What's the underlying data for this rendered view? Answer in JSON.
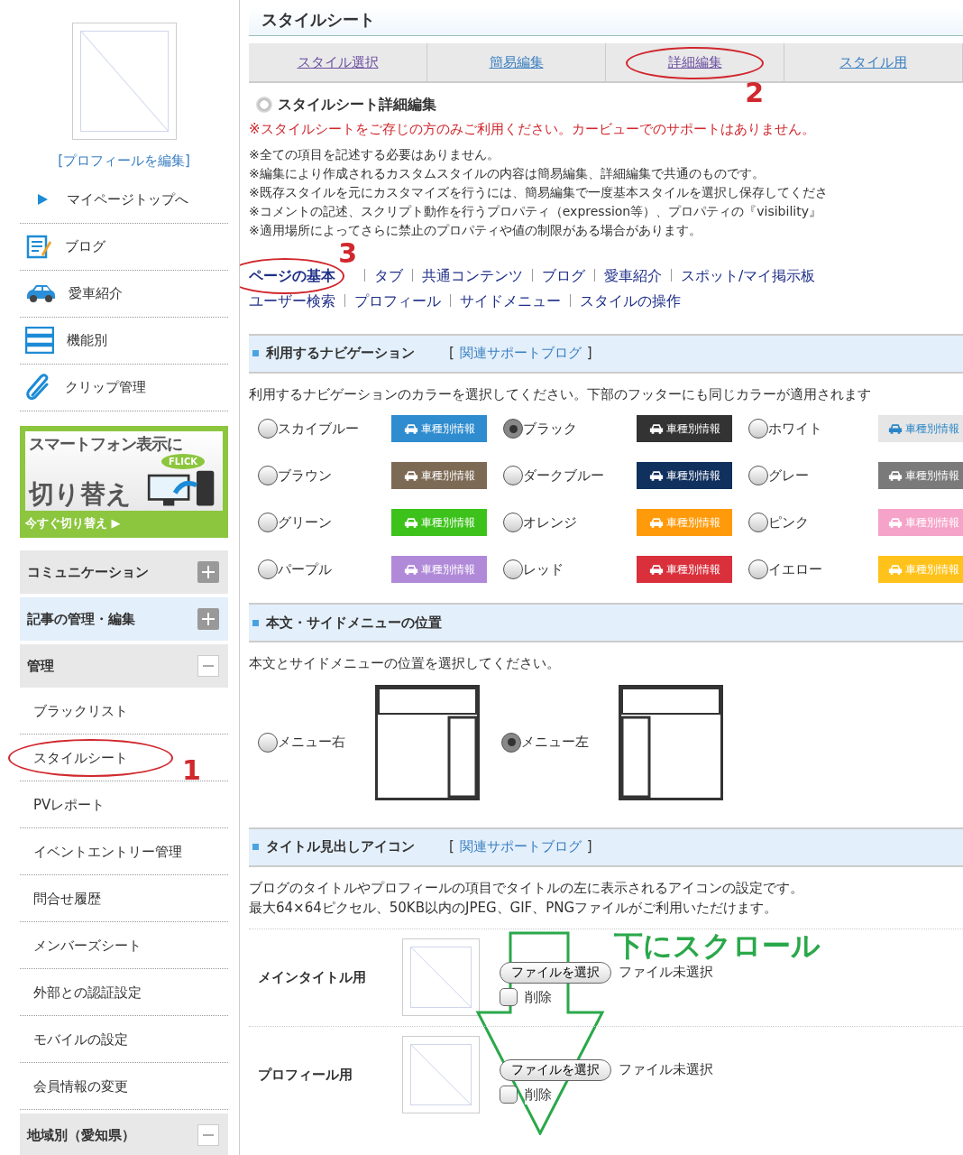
{
  "sidebar": {
    "profile_link": "[プロフィールを編集]",
    "menu": [
      {
        "label": "マイページトップへ",
        "kind": "top"
      },
      {
        "label": "ブログ",
        "kind": "blog"
      },
      {
        "label": "愛車紹介",
        "kind": "car"
      },
      {
        "label": "機能別",
        "kind": "list"
      },
      {
        "label": "クリップ管理",
        "kind": "clip"
      }
    ],
    "banner": {
      "title_1": "スマートフォン表示に",
      "title_2": "切り替え",
      "badge": "FLICK",
      "action": "今すぐ切り替え ▶"
    },
    "sections": [
      {
        "label": "コミュニケーション",
        "expanded": false,
        "kind": "gray"
      },
      {
        "label": "記事の管理・編集",
        "expanded": false,
        "kind": "blue"
      },
      {
        "label": "管理",
        "expanded": true,
        "kind": "gray",
        "items": [
          {
            "label": "ブラックリスト"
          },
          {
            "label": "スタイルシート",
            "marker": "1"
          },
          {
            "label": "PVレポート"
          },
          {
            "label": "イベントエントリー管理"
          },
          {
            "label": "問合せ履歴"
          },
          {
            "label": "メンバーズシート"
          },
          {
            "label": "外部との認証設定"
          },
          {
            "label": "モバイルの設定"
          },
          {
            "label": "会員情報の変更"
          }
        ]
      },
      {
        "label": "地域別（愛知県）",
        "expanded": true,
        "kind": "gray"
      }
    ]
  },
  "page_title": "スタイルシート",
  "tabs": [
    {
      "label": "スタイル選択",
      "visited": true
    },
    {
      "label": "簡易編集",
      "visited": false
    },
    {
      "label": "詳細編集",
      "visited": true,
      "marker": "2"
    },
    {
      "label": "スタイル用",
      "visited": false
    }
  ],
  "heading": "スタイルシート詳細編集",
  "warning": "※スタイルシートをご存じの方のみご利用ください。カービューでのサポートはありません。",
  "notes": [
    "※全ての項目を記述する必要はありません。",
    "※編集により作成されるカスタムスタイルの内容は簡易編集、詳細編集で共通のものです。",
    "※既存スタイルを元にカスタマイズを行うには、簡易編集で一度基本スタイルを選択し保存してくださ",
    "※コメントの記述、スクリプト動作を行うプロパティ（expression等）、プロパティの『visibility』",
    "※適用場所によってさらに禁止のプロパティや値の制限がある場合があります。"
  ],
  "nav_links": [
    {
      "label": "ページの基本",
      "selected": true,
      "marker": "3"
    },
    {
      "label": "タブ",
      "selected": false
    },
    {
      "label": "共通コンテンツ",
      "selected": false
    },
    {
      "label": "ブログ",
      "selected": false
    },
    {
      "label": "愛車紹介",
      "selected": false
    },
    {
      "label": "スポット/マイ掲示板",
      "selected": false
    },
    {
      "label": "ユーザー検索",
      "selected": false
    },
    {
      "label": "プロフィール",
      "selected": false
    },
    {
      "label": "サイドメニュー",
      "selected": false
    },
    {
      "label": "スタイルの操作",
      "selected": false
    }
  ],
  "navigation_section": {
    "title": "利用するナビゲーション",
    "bracket_open": "[",
    "link": "関連サポートブログ",
    "bracket_close": "]",
    "description": "利用するナビゲーションのカラーを選択してください。下部のフッターにも同じカラーが適用されます",
    "options": [
      {
        "label": "スカイブルー",
        "selected": false,
        "color": "#2f8ccf",
        "sample": "車種別情報"
      },
      {
        "label": "ブラック",
        "selected": true,
        "color": "#333333",
        "sample": "車種別情報"
      },
      {
        "label": "ホワイト",
        "selected": false,
        "color": "#e6e6e6",
        "sample": "車種別情報"
      },
      {
        "label": "ブラウン",
        "selected": false,
        "color": "#7d6a55",
        "sample": "車種別情報"
      },
      {
        "label": "ダークブルー",
        "selected": false,
        "color": "#10305e",
        "sample": "車種別情報"
      },
      {
        "label": "グレー",
        "selected": false,
        "color": "#7a7a7a",
        "sample": "車種別情報"
      },
      {
        "label": "グリーン",
        "selected": false,
        "color": "#3cc21a",
        "sample": "車種別情報"
      },
      {
        "label": "オレンジ",
        "selected": false,
        "color": "#ff9a0a",
        "sample": "車種別情報"
      },
      {
        "label": "ピンク",
        "selected": false,
        "color": "#f5a3c8",
        "sample": "車種別情報"
      },
      {
        "label": "パープル",
        "selected": false,
        "color": "#b08ad8",
        "sample": "車種別情報"
      },
      {
        "label": "レッド",
        "selected": false,
        "color": "#d9303c",
        "sample": "車種別情報"
      },
      {
        "label": "イエロー",
        "selected": false,
        "color": "#ffc21a",
        "sample": "車種別情報"
      }
    ]
  },
  "position_section": {
    "title": "本文・サイドメニューの位置",
    "description": "本文とサイドメニューの位置を選択してください。",
    "options": [
      {
        "label": "メニュー右",
        "selected": false,
        "menu_on_left": false
      },
      {
        "label": "メニュー左",
        "selected": true,
        "menu_on_left": true
      }
    ]
  },
  "icon_section": {
    "title": "タイトル見出しアイコン",
    "bracket_open": "[",
    "link": "関連サポートブログ",
    "bracket_close": "]",
    "description": [
      "ブログのタイトルやプロフィールの項目でタイトルの左に表示されるアイコンの設定です。",
      "最大64×64ピクセル、50KB以内のJPEG、GIF、PNGファイルがご利用いただけます。"
    ],
    "rows": [
      {
        "label": "メインタイトル用",
        "file_button": "ファイルを選択",
        "file_status": "ファイル未選択",
        "delete_label": "削除",
        "delete_checked": false
      },
      {
        "label": "プロフィール用",
        "file_button": "ファイルを選択",
        "file_status": "ファイル未選択",
        "delete_label": "削除",
        "delete_checked": false
      }
    ],
    "scroll_hint": "下にスクロール"
  }
}
